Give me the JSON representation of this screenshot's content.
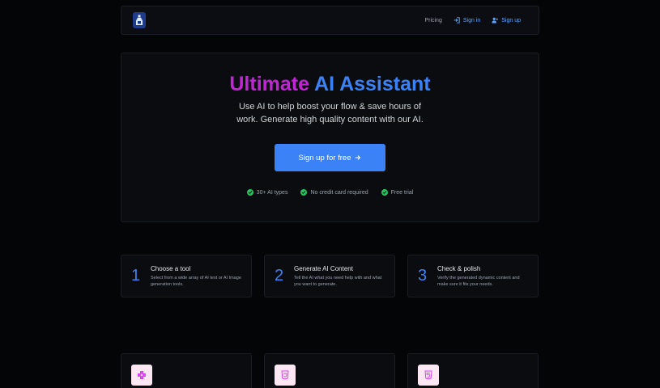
{
  "nav": {
    "pricing": "Pricing",
    "sign_in": "Sign in",
    "sign_up": "Sign up",
    "logo_icon": "bottle-logo-icon"
  },
  "hero": {
    "title_part1": "Ultimate",
    "title_part2": "AI Assistant",
    "subtitle": "Use AI to help boost your flow & save hours of work. Generate high quality content with our AI.",
    "cta_label": "Sign up for free",
    "cta_icon": "arrow-right-icon",
    "features": [
      "30+ AI types",
      "No credit card required",
      "Free trial"
    ]
  },
  "steps": [
    {
      "num": "1",
      "title": "Choose a tool",
      "desc": "Select from a wide array of AI text or AI Image generation tools."
    },
    {
      "num": "2",
      "title": "Generate AI Content",
      "desc": "Tell the AI what you need help with and what you want to generate."
    },
    {
      "num": "3",
      "title": "Check & polish",
      "desc": "Verify the generated dynamic content and make sure it fits your needs."
    }
  ],
  "tools": [
    {
      "icon": "puzzle-icon"
    },
    {
      "icon": "css3-icon"
    },
    {
      "icon": "html5-icon"
    }
  ],
  "colors": {
    "accent": "#3b82f6",
    "magenta": "#c026d3",
    "success": "#22c55e",
    "background": "#040507"
  }
}
